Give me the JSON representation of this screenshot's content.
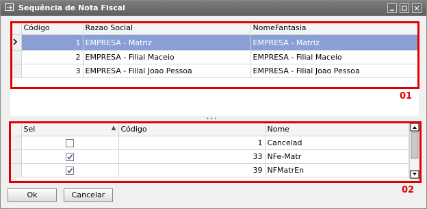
{
  "window": {
    "title": "Sequência de Nota Fiscal"
  },
  "grid1": {
    "columns": [
      "Código",
      "Razao Social",
      "NomeFantasia"
    ],
    "rows": [
      {
        "codigo": "1",
        "razao": "EMPRESA - Matriz",
        "fantasia": "EMPRESA - Matriz"
      },
      {
        "codigo": "2",
        "razao": "EMPRESA - Filial Maceio",
        "fantasia": "EMPRESA - Filial Maceio"
      },
      {
        "codigo": "3",
        "razao": "EMPRESA - Filial Joao Pessoa",
        "fantasia": "EMPRESA - Filial Joao Pessoa"
      }
    ],
    "selected_row": 0,
    "annotation": "01"
  },
  "grid2": {
    "columns": [
      "Sel",
      "Código",
      "Nome"
    ],
    "sort_indicator": "▲",
    "rows": [
      {
        "sel": false,
        "codigo": "1",
        "nome": "Cancelad"
      },
      {
        "sel": true,
        "codigo": "33",
        "nome": "NFe-Matr"
      },
      {
        "sel": true,
        "codigo": "39",
        "nome": "NFMatrEn"
      }
    ],
    "annotation": "02"
  },
  "buttons": {
    "ok": "Ok",
    "cancel": "Cancelar"
  },
  "colors": {
    "selection": "#8a9fd6",
    "annotation": "#e00000",
    "titlebar": "#6e6e6e"
  }
}
